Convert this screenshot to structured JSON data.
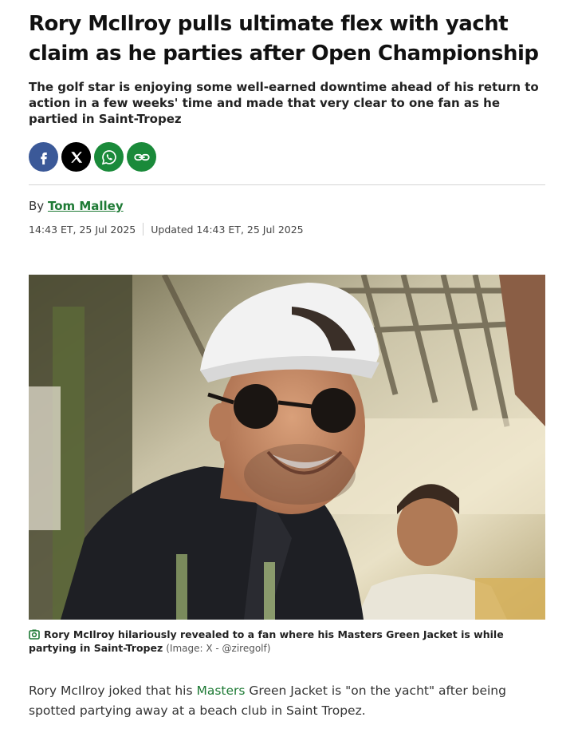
{
  "article": {
    "headline": "Rory McIlroy pulls ultimate flex with yacht claim as he parties after Open Championship",
    "standfirst": "The golf star is enjoying some well-earned downtime ahead of his return to action in a few weeks' time and made that very clear to one fan as he partied in Saint-Tropez",
    "byline_prefix": "By",
    "author": "Tom Malley",
    "published": "14:43 ET, 25 Jul 2025",
    "updated": "Updated 14:43 ET, 25 Jul 2025",
    "caption": "Rory McIlroy hilariously revealed to a fan where his Masters Green Jacket is while partying in Saint-Tropez",
    "credit": "(Image: X - @ziregolf)",
    "body_before_link": "Rory McIlroy joked that his ",
    "body_link": "Masters",
    "body_after_link": " Green Jacket is \"on the yacht\" after being spotted partying away at a beach club in Saint Tropez."
  },
  "share": {
    "items": [
      {
        "icon": "facebook-icon",
        "color": "#3b5998"
      },
      {
        "icon": "x-icon",
        "color": "#000000"
      },
      {
        "icon": "whatsapp-icon",
        "color": "#1a8a3a"
      },
      {
        "icon": "link-icon",
        "color": "#1a8a3a"
      }
    ]
  },
  "colors": {
    "accent_green": "#1e7a35",
    "facebook_blue": "#3b5998"
  }
}
